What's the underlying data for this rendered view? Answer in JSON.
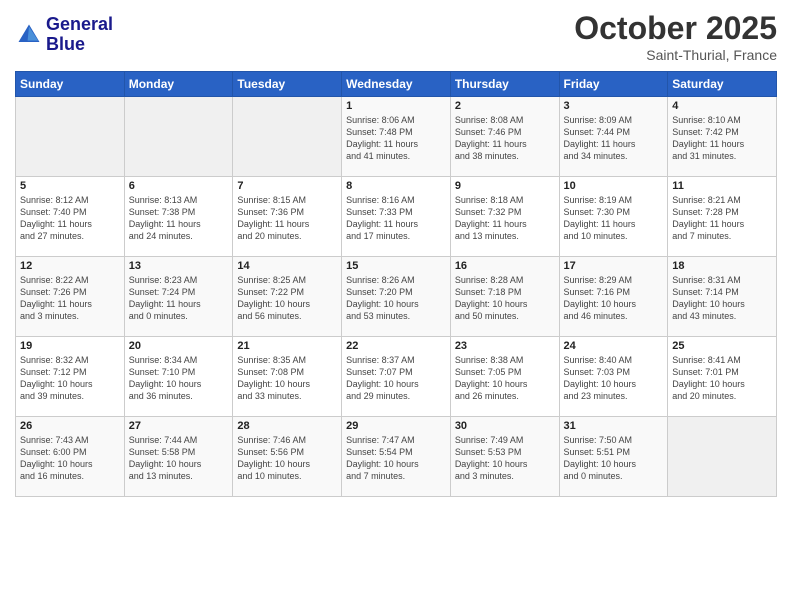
{
  "logo": {
    "line1": "General",
    "line2": "Blue"
  },
  "header": {
    "month": "October 2025",
    "location": "Saint-Thurial, France"
  },
  "weekdays": [
    "Sunday",
    "Monday",
    "Tuesday",
    "Wednesday",
    "Thursday",
    "Friday",
    "Saturday"
  ],
  "weeks": [
    [
      {
        "day": "",
        "info": ""
      },
      {
        "day": "",
        "info": ""
      },
      {
        "day": "",
        "info": ""
      },
      {
        "day": "1",
        "info": "Sunrise: 8:06 AM\nSunset: 7:48 PM\nDaylight: 11 hours\nand 41 minutes."
      },
      {
        "day": "2",
        "info": "Sunrise: 8:08 AM\nSunset: 7:46 PM\nDaylight: 11 hours\nand 38 minutes."
      },
      {
        "day": "3",
        "info": "Sunrise: 8:09 AM\nSunset: 7:44 PM\nDaylight: 11 hours\nand 34 minutes."
      },
      {
        "day": "4",
        "info": "Sunrise: 8:10 AM\nSunset: 7:42 PM\nDaylight: 11 hours\nand 31 minutes."
      }
    ],
    [
      {
        "day": "5",
        "info": "Sunrise: 8:12 AM\nSunset: 7:40 PM\nDaylight: 11 hours\nand 27 minutes."
      },
      {
        "day": "6",
        "info": "Sunrise: 8:13 AM\nSunset: 7:38 PM\nDaylight: 11 hours\nand 24 minutes."
      },
      {
        "day": "7",
        "info": "Sunrise: 8:15 AM\nSunset: 7:36 PM\nDaylight: 11 hours\nand 20 minutes."
      },
      {
        "day": "8",
        "info": "Sunrise: 8:16 AM\nSunset: 7:33 PM\nDaylight: 11 hours\nand 17 minutes."
      },
      {
        "day": "9",
        "info": "Sunrise: 8:18 AM\nSunset: 7:32 PM\nDaylight: 11 hours\nand 13 minutes."
      },
      {
        "day": "10",
        "info": "Sunrise: 8:19 AM\nSunset: 7:30 PM\nDaylight: 11 hours\nand 10 minutes."
      },
      {
        "day": "11",
        "info": "Sunrise: 8:21 AM\nSunset: 7:28 PM\nDaylight: 11 hours\nand 7 minutes."
      }
    ],
    [
      {
        "day": "12",
        "info": "Sunrise: 8:22 AM\nSunset: 7:26 PM\nDaylight: 11 hours\nand 3 minutes."
      },
      {
        "day": "13",
        "info": "Sunrise: 8:23 AM\nSunset: 7:24 PM\nDaylight: 11 hours\nand 0 minutes."
      },
      {
        "day": "14",
        "info": "Sunrise: 8:25 AM\nSunset: 7:22 PM\nDaylight: 10 hours\nand 56 minutes."
      },
      {
        "day": "15",
        "info": "Sunrise: 8:26 AM\nSunset: 7:20 PM\nDaylight: 10 hours\nand 53 minutes."
      },
      {
        "day": "16",
        "info": "Sunrise: 8:28 AM\nSunset: 7:18 PM\nDaylight: 10 hours\nand 50 minutes."
      },
      {
        "day": "17",
        "info": "Sunrise: 8:29 AM\nSunset: 7:16 PM\nDaylight: 10 hours\nand 46 minutes."
      },
      {
        "day": "18",
        "info": "Sunrise: 8:31 AM\nSunset: 7:14 PM\nDaylight: 10 hours\nand 43 minutes."
      }
    ],
    [
      {
        "day": "19",
        "info": "Sunrise: 8:32 AM\nSunset: 7:12 PM\nDaylight: 10 hours\nand 39 minutes."
      },
      {
        "day": "20",
        "info": "Sunrise: 8:34 AM\nSunset: 7:10 PM\nDaylight: 10 hours\nand 36 minutes."
      },
      {
        "day": "21",
        "info": "Sunrise: 8:35 AM\nSunset: 7:08 PM\nDaylight: 10 hours\nand 33 minutes."
      },
      {
        "day": "22",
        "info": "Sunrise: 8:37 AM\nSunset: 7:07 PM\nDaylight: 10 hours\nand 29 minutes."
      },
      {
        "day": "23",
        "info": "Sunrise: 8:38 AM\nSunset: 7:05 PM\nDaylight: 10 hours\nand 26 minutes."
      },
      {
        "day": "24",
        "info": "Sunrise: 8:40 AM\nSunset: 7:03 PM\nDaylight: 10 hours\nand 23 minutes."
      },
      {
        "day": "25",
        "info": "Sunrise: 8:41 AM\nSunset: 7:01 PM\nDaylight: 10 hours\nand 20 minutes."
      }
    ],
    [
      {
        "day": "26",
        "info": "Sunrise: 7:43 AM\nSunset: 6:00 PM\nDaylight: 10 hours\nand 16 minutes."
      },
      {
        "day": "27",
        "info": "Sunrise: 7:44 AM\nSunset: 5:58 PM\nDaylight: 10 hours\nand 13 minutes."
      },
      {
        "day": "28",
        "info": "Sunrise: 7:46 AM\nSunset: 5:56 PM\nDaylight: 10 hours\nand 10 minutes."
      },
      {
        "day": "29",
        "info": "Sunrise: 7:47 AM\nSunset: 5:54 PM\nDaylight: 10 hours\nand 7 minutes."
      },
      {
        "day": "30",
        "info": "Sunrise: 7:49 AM\nSunset: 5:53 PM\nDaylight: 10 hours\nand 3 minutes."
      },
      {
        "day": "31",
        "info": "Sunrise: 7:50 AM\nSunset: 5:51 PM\nDaylight: 10 hours\nand 0 minutes."
      },
      {
        "day": "",
        "info": ""
      }
    ]
  ]
}
